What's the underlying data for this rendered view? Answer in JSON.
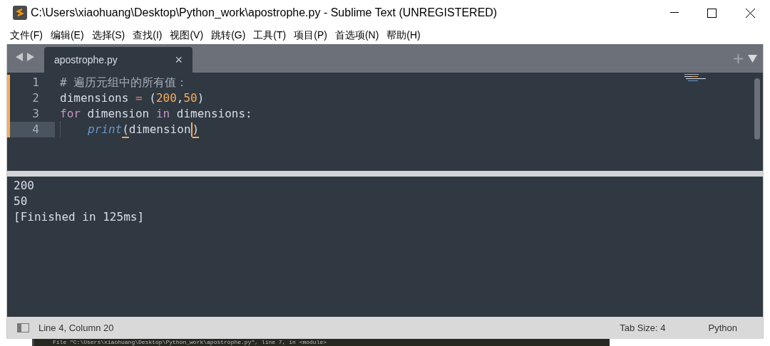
{
  "window": {
    "title": "C:\\Users\\xiaohuang\\Desktop\\Python_work\\apostrophe.py - Sublime Text (UNREGISTERED)"
  },
  "menu": [
    "文件(F)",
    "编辑(E)",
    "选择(S)",
    "查找(I)",
    "视图(V)",
    "跳转(G)",
    "工具(T)",
    "项目(P)",
    "首选项(N)",
    "帮助(H)"
  ],
  "tabs": [
    {
      "label": "apostrophe.py",
      "selected": true,
      "close": "×"
    }
  ],
  "editor": {
    "lines": [
      {
        "number": "1",
        "modified": true,
        "current": false,
        "indented": false,
        "tokens": [
          {
            "kind": "comment",
            "text": "# 遍历元组中的所有值："
          }
        ]
      },
      {
        "number": "2",
        "modified": true,
        "current": false,
        "indented": false,
        "tokens": [
          {
            "kind": "plain",
            "text": "dimensions "
          },
          {
            "kind": "operator",
            "text": "="
          },
          {
            "kind": "plain",
            "text": " ("
          },
          {
            "kind": "number",
            "text": "200"
          },
          {
            "kind": "plain",
            "text": ","
          },
          {
            "kind": "number",
            "text": "50"
          },
          {
            "kind": "plain",
            "text": ")"
          }
        ]
      },
      {
        "number": "3",
        "modified": true,
        "current": false,
        "indented": false,
        "tokens": [
          {
            "kind": "keyword",
            "text": "for"
          },
          {
            "kind": "plain",
            "text": " dimension "
          },
          {
            "kind": "keyword",
            "text": "in"
          },
          {
            "kind": "plain",
            "text": " dimensions:"
          }
        ]
      },
      {
        "number": "4",
        "modified": true,
        "current": true,
        "indented": true,
        "tokens": [
          {
            "kind": "builtin",
            "text": "print"
          },
          {
            "kind": "bracket",
            "text": "("
          },
          {
            "kind": "plain",
            "text": "dimension",
            "caret_after": true
          },
          {
            "kind": "bracket",
            "text": ")"
          }
        ]
      }
    ]
  },
  "output": [
    "200",
    "50",
    "[Finished in 125ms]"
  ],
  "status_bar": {
    "position": "Line 4, Column 20",
    "tab_size": "Tab Size: 4",
    "syntax": "Python"
  },
  "background_window": {
    "text": "File \"C:\\Users\\xiaohuang\\Desktop\\Python_work\\apostrophe.py\", line 7, in <module>"
  }
}
